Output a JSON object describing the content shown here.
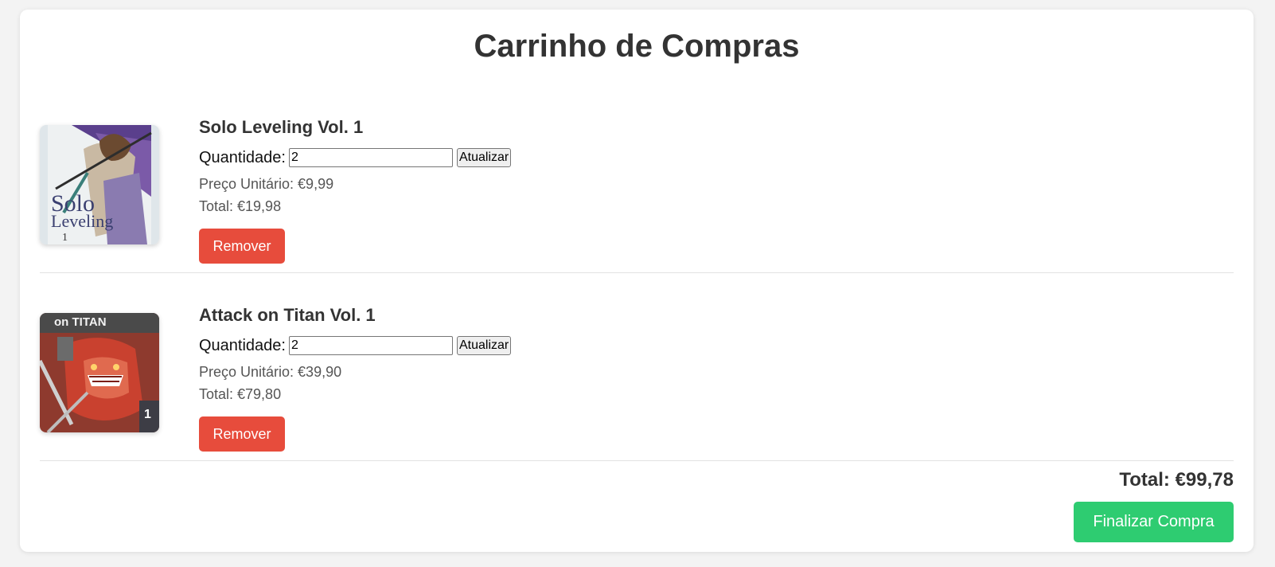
{
  "page": {
    "title": "Carrinho de Compras"
  },
  "items": [
    {
      "title": "Solo Leveling Vol. 1",
      "quantity_label": "Quantidade:",
      "quantity_value": "2",
      "update_label": "Atualizar",
      "unit_price": "Preço Unitário: €9,99",
      "total": "Total: €19,98",
      "remove_label": "Remover",
      "cover": {
        "text_line1": "Solo",
        "text_line2": "Leveling",
        "volume": "1"
      }
    },
    {
      "title": "Attack on Titan Vol. 1",
      "quantity_label": "Quantidade:",
      "quantity_value": "2",
      "update_label": "Atualizar",
      "unit_price": "Preço Unitário: €39,90",
      "total": "Total: €79,80",
      "remove_label": "Remover",
      "cover": {
        "text_top": "on TITAN",
        "volume": "1"
      }
    }
  ],
  "summary": {
    "total": "Total: €99,78",
    "checkout_label": "Finalizar Compra"
  },
  "colors": {
    "remove": "#e74c3c",
    "checkout": "#2ecc71",
    "background": "#f3f3f3"
  }
}
